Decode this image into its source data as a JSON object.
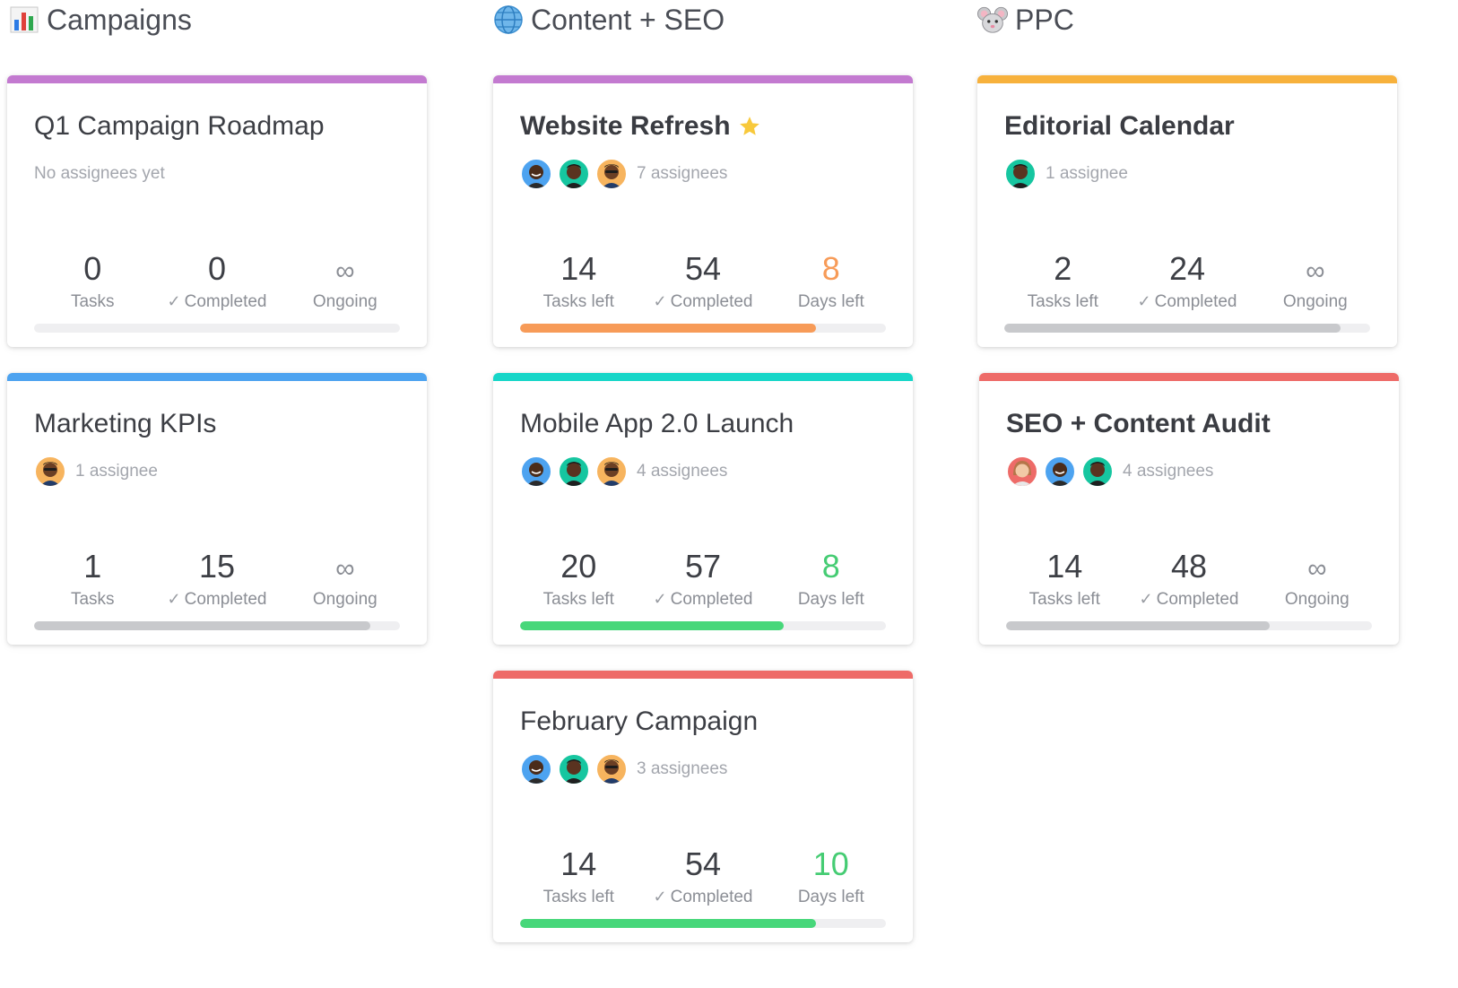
{
  "columns": [
    {
      "title": "Campaigns",
      "icon": "bar-chart-icon"
    },
    {
      "title": "Content + SEO",
      "icon": "globe-icon"
    },
    {
      "title": "PPC",
      "icon": "mouse-face-icon"
    }
  ],
  "colors": {
    "purple": "#c37ad0",
    "blue": "#4da3f0",
    "teal": "#16d6c8",
    "red": "#ee6b68",
    "orange": "#f7a234",
    "progress_orange": "#f79b58",
    "progress_green": "#47d77a",
    "progress_gray": "#c8c9cc",
    "days_orange": "#f79b58",
    "days_green": "#45cc73",
    "star": "#f8c93b"
  },
  "cards": {
    "q1": {
      "title": "Q1 Campaign Roadmap",
      "assignees": "No assignees yet",
      "stat1": {
        "value": "0",
        "label": "Tasks"
      },
      "stat2": {
        "value": "0",
        "label": "Completed"
      },
      "stat3": {
        "value": "∞",
        "label": "Ongoing"
      },
      "progress": 0
    },
    "kpis": {
      "title": "Marketing KPIs",
      "assignees": "1 assignee",
      "stat1": {
        "value": "1",
        "label": "Tasks"
      },
      "stat2": {
        "value": "15",
        "label": "Completed"
      },
      "stat3": {
        "value": "∞",
        "label": "Ongoing"
      },
      "progress": 0.92
    },
    "website": {
      "title": "Website Refresh",
      "assignees": "7 assignees",
      "stat1": {
        "value": "14",
        "label": "Tasks left"
      },
      "stat2": {
        "value": "54",
        "label": "Completed"
      },
      "stat3": {
        "value": "8",
        "label": "Days left"
      },
      "progress": 0.81
    },
    "mobile": {
      "title": "Mobile App 2.0 Launch",
      "assignees": "4 assignees",
      "stat1": {
        "value": "20",
        "label": "Tasks left"
      },
      "stat2": {
        "value": "57",
        "label": "Completed"
      },
      "stat3": {
        "value": "8",
        "label": "Days left"
      },
      "progress": 0.72
    },
    "february": {
      "title": "February Campaign",
      "assignees": "3 assignees",
      "stat1": {
        "value": "14",
        "label": "Tasks left"
      },
      "stat2": {
        "value": "54",
        "label": "Completed"
      },
      "stat3": {
        "value": "10",
        "label": "Days left"
      },
      "progress": 0.81
    },
    "editorial": {
      "title": "Editorial Calendar",
      "assignees": "1 assignee",
      "stat1": {
        "value": "2",
        "label": "Tasks left"
      },
      "stat2": {
        "value": "24",
        "label": "Completed"
      },
      "stat3": {
        "value": "∞",
        "label": "Ongoing"
      },
      "progress": 0.92
    },
    "audit": {
      "title": "SEO + Content Audit",
      "assignees": "4 assignees",
      "stat1": {
        "value": "14",
        "label": "Tasks left"
      },
      "stat2": {
        "value": "48",
        "label": "Completed"
      },
      "stat3": {
        "value": "∞",
        "label": "Ongoing"
      },
      "progress": 0.72
    }
  }
}
